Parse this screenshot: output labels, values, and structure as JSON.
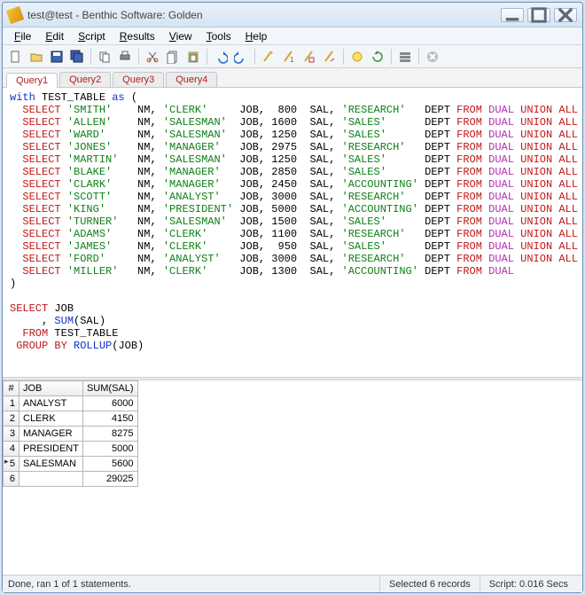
{
  "window": {
    "title": "test@test - Benthic Software: Golden"
  },
  "menu": [
    "File",
    "Edit",
    "Script",
    "Results",
    "View",
    "Tools",
    "Help"
  ],
  "tabs": [
    {
      "label": "Query1",
      "active": true
    },
    {
      "label": "Query2",
      "active": false
    },
    {
      "label": "Query3",
      "active": false
    },
    {
      "label": "Query4",
      "active": false
    }
  ],
  "sql_rows": [
    {
      "name": "SMITH",
      "role": "CLERK",
      "sal": 800,
      "dept": "RESEARCH",
      "cont": true
    },
    {
      "name": "ALLEN",
      "role": "SALESMAN",
      "sal": 1600,
      "dept": "SALES",
      "cont": true
    },
    {
      "name": "WARD",
      "role": "SALESMAN",
      "sal": 1250,
      "dept": "SALES",
      "cont": true
    },
    {
      "name": "JONES",
      "role": "MANAGER",
      "sal": 2975,
      "dept": "RESEARCH",
      "cont": true
    },
    {
      "name": "MARTIN",
      "role": "SALESMAN",
      "sal": 1250,
      "dept": "SALES",
      "cont": true
    },
    {
      "name": "BLAKE",
      "role": "MANAGER",
      "sal": 2850,
      "dept": "SALES",
      "cont": true
    },
    {
      "name": "CLARK",
      "role": "MANAGER",
      "sal": 2450,
      "dept": "ACCOUNTING",
      "cont": true
    },
    {
      "name": "SCOTT",
      "role": "ANALYST",
      "sal": 3000,
      "dept": "RESEARCH",
      "cont": true
    },
    {
      "name": "KING",
      "role": "PRESIDENT",
      "sal": 5000,
      "dept": "ACCOUNTING",
      "cont": true
    },
    {
      "name": "TURNER",
      "role": "SALESMAN",
      "sal": 1500,
      "dept": "SALES",
      "cont": true
    },
    {
      "name": "ADAMS",
      "role": "CLERK",
      "sal": 1100,
      "dept": "RESEARCH",
      "cont": true
    },
    {
      "name": "JAMES",
      "role": "CLERK",
      "sal": 950,
      "dept": "SALES",
      "cont": true
    },
    {
      "name": "FORD",
      "role": "ANALYST",
      "sal": 3000,
      "dept": "RESEARCH",
      "cont": true
    },
    {
      "name": "MILLER",
      "role": "CLERK",
      "sal": 1300,
      "dept": "ACCOUNTING",
      "cont": false
    }
  ],
  "sql_tail": [
    ")",
    "",
    "SELECT JOB",
    "     , SUM(SAL)",
    "  FROM TEST_TABLE",
    " GROUP BY ROLLUP(JOB)"
  ],
  "grid": {
    "row_header": "#",
    "columns": [
      "JOB",
      "SUM(SAL)"
    ],
    "rows": [
      {
        "n": "1",
        "job": "ANALYST",
        "sum": "6000",
        "current": false
      },
      {
        "n": "2",
        "job": "CLERK",
        "sum": "4150",
        "current": false
      },
      {
        "n": "3",
        "job": "MANAGER",
        "sum": "8275",
        "current": false
      },
      {
        "n": "4",
        "job": "PRESIDENT",
        "sum": "5000",
        "current": false
      },
      {
        "n": "5",
        "job": "SALESMAN",
        "sum": "5600",
        "current": true
      },
      {
        "n": "6",
        "job": "",
        "sum": "29025",
        "current": false
      }
    ]
  },
  "status": {
    "left": "Done, ran 1 of 1 statements.",
    "mid": "Selected 6 records",
    "right": "Script: 0.016 Secs"
  },
  "chart_data": {
    "type": "table",
    "title": "SUM(SAL) grouped by JOB with ROLLUP",
    "columns": [
      "JOB",
      "SUM(SAL)"
    ],
    "rows": [
      [
        "ANALYST",
        6000
      ],
      [
        "CLERK",
        4150
      ],
      [
        "MANAGER",
        8275
      ],
      [
        "PRESIDENT",
        5000
      ],
      [
        "SALESMAN",
        5600
      ],
      [
        null,
        29025
      ]
    ]
  }
}
